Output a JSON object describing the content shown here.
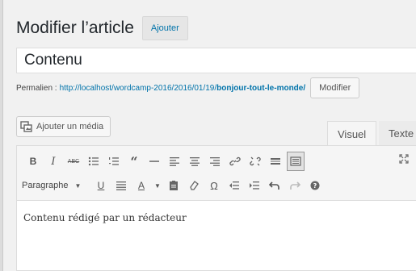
{
  "header": {
    "title": "Modifier l’article",
    "add_new_label": "Ajouter"
  },
  "post": {
    "title_value": "Contenu",
    "permalink_label": "Permalien :",
    "permalink_base": "http://localhost/wordcamp-2016/2016/01/19/",
    "permalink_slug": "bonjour-tout-le-monde/",
    "permalink_edit_label": "Modifier"
  },
  "media": {
    "add_media_label": "Ajouter un média"
  },
  "editor": {
    "tabs": {
      "visual": "Visuel",
      "text": "Texte"
    },
    "format_select": "Paragraphe",
    "content": "Contenu rédigé par un rédacteur",
    "toolbar_row1_icons": [
      "bold-icon",
      "italic-icon",
      "strikethrough-icon",
      "bullet-list-icon",
      "numbered-list-icon",
      "blockquote-icon",
      "horizontal-rule-icon",
      "align-left-icon",
      "align-center-icon",
      "align-right-icon",
      "insert-link-icon",
      "remove-link-icon",
      "read-more-icon",
      "toolbar-toggle-icon"
    ],
    "toolbar_row2_icons": [
      "underline-icon",
      "justify-icon",
      "text-color-icon",
      "paste-text-icon",
      "clear-formatting-icon",
      "special-char-icon",
      "outdent-icon",
      "indent-icon",
      "undo-icon",
      "redo-icon",
      "help-icon"
    ]
  },
  "colors": {
    "link": "#0073aa",
    "background": "#f1f1f1",
    "toolbar_bg": "#f5f5f5"
  }
}
